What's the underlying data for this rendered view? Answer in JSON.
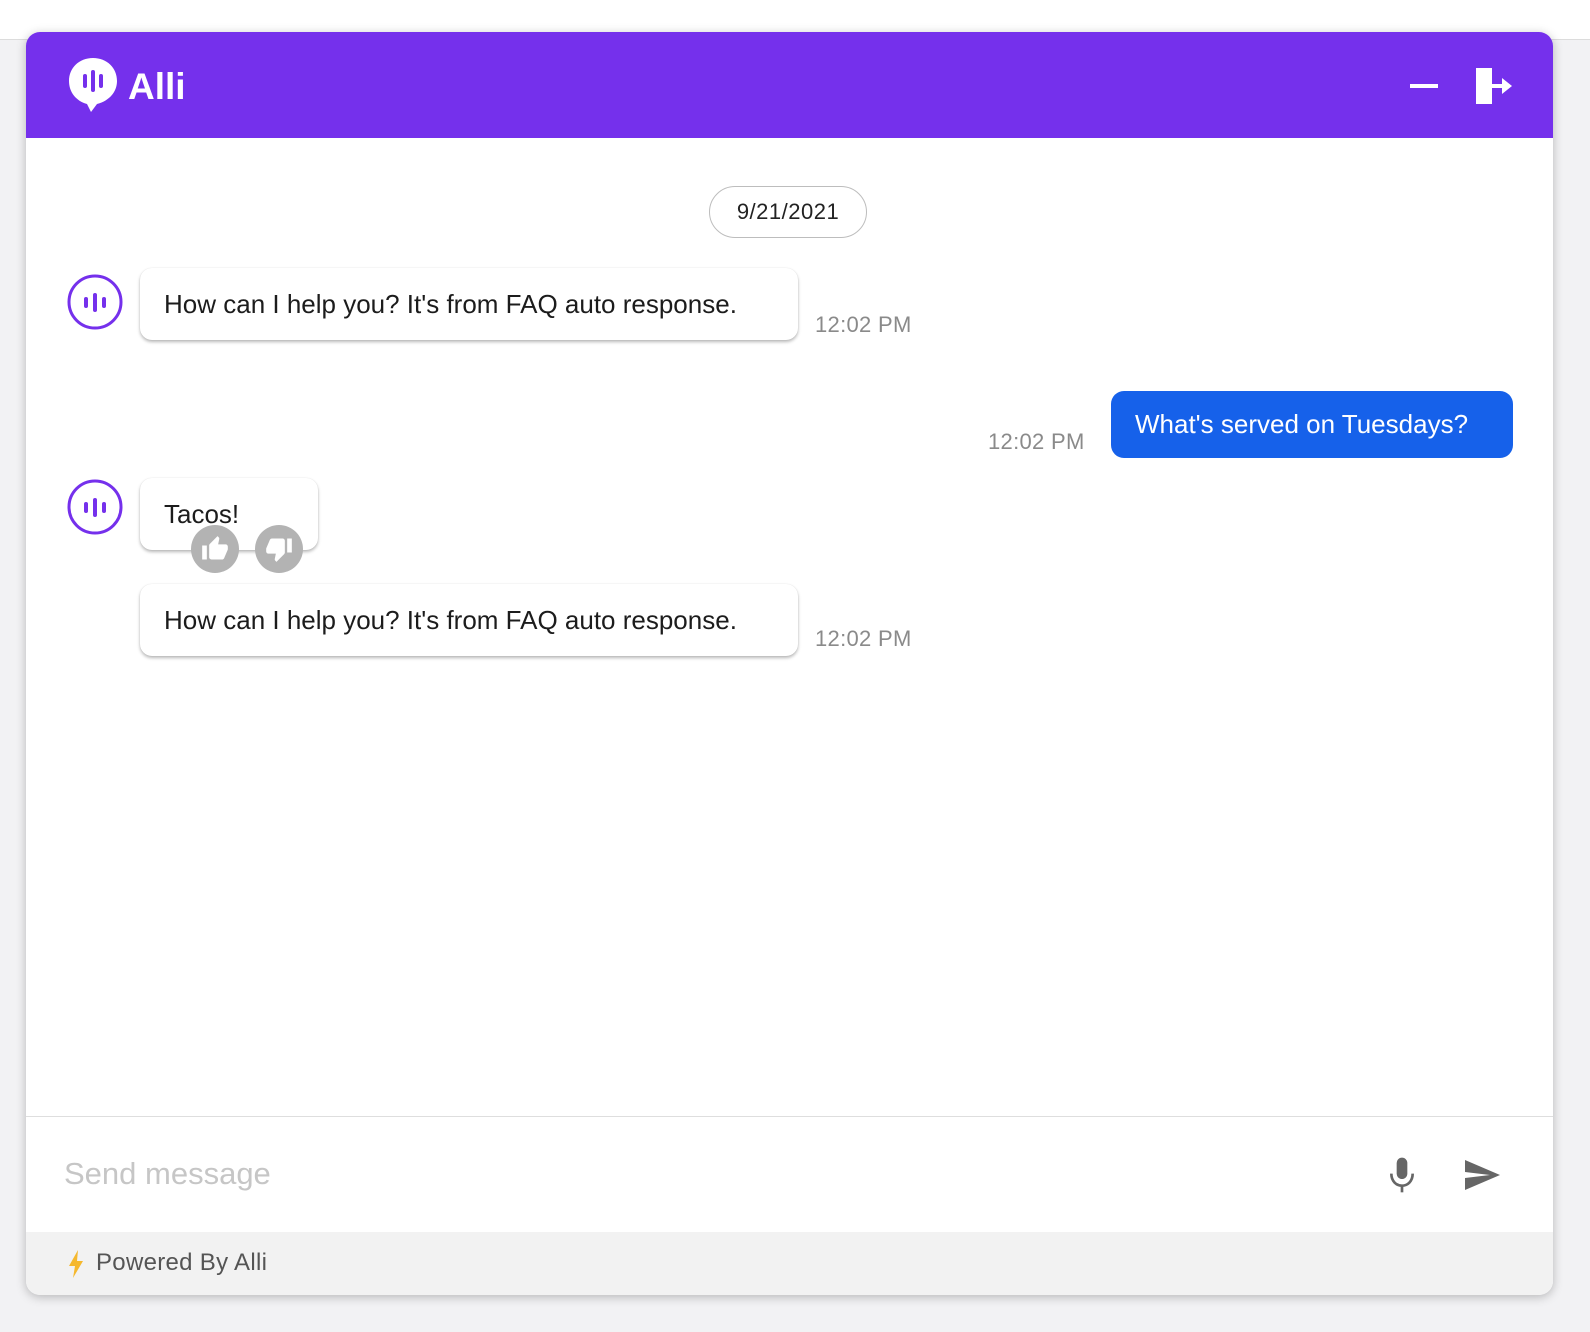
{
  "header": {
    "title": "Alli",
    "background_color": "#7530ec",
    "logo_icon": "alli-logo-icon",
    "minimize_icon": "minimize-icon",
    "exit_icon": "exit-icon"
  },
  "conversation": {
    "date": "9/21/2021",
    "messages": [
      {
        "sender": "bot",
        "text": "How can I help you? It's from FAQ auto response.",
        "time": "12:02 PM"
      },
      {
        "sender": "user",
        "text": "What's served on Tuesdays?",
        "time": "12:02 PM"
      },
      {
        "sender": "bot",
        "text": "Tacos!",
        "feedback": [
          "thumbs-up-icon",
          "thumbs-down-icon"
        ]
      },
      {
        "sender": "bot",
        "text": "How can I help you? It's from FAQ auto response.",
        "time": "12:02 PM"
      }
    ],
    "bot_avatar_icon": "alli-avatar-icon",
    "user_bubble_color": "#1661ea"
  },
  "composer": {
    "placeholder": "Send message",
    "value": "",
    "mic_icon": "microphone-icon",
    "send_icon": "send-icon"
  },
  "footer": {
    "text": "Powered By Alli",
    "icon": "lightning-bolt-icon",
    "icon_color": "#f5b82e"
  }
}
